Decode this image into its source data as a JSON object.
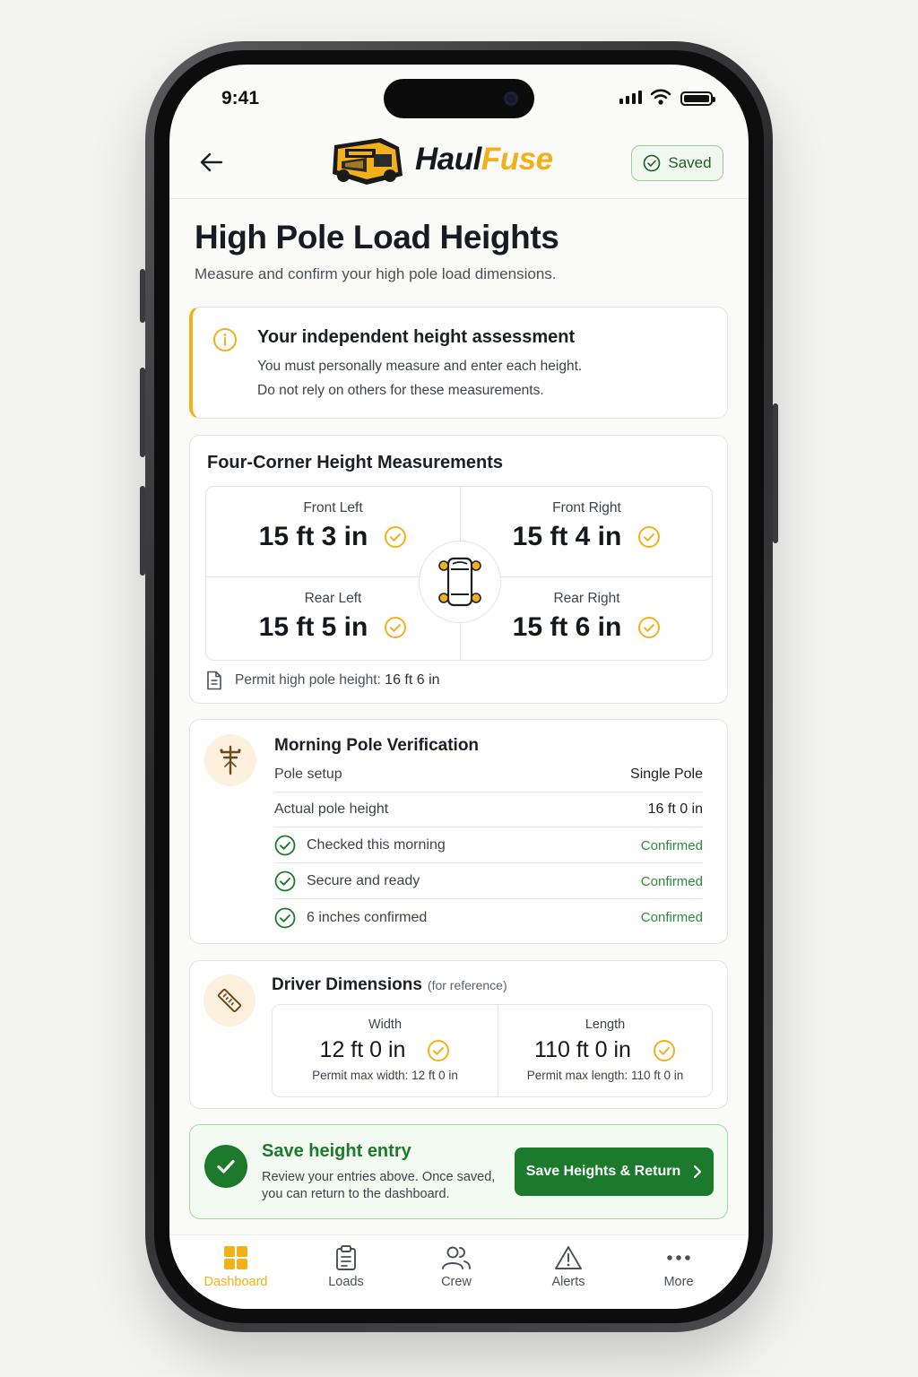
{
  "status": {
    "time": "9:41"
  },
  "header": {
    "brand_haul": "Haul",
    "brand_fuse": "Fuse",
    "saved_label": "Saved"
  },
  "page": {
    "title": "High Pole Load Heights",
    "subtitle": "Measure and confirm your high pole load dimensions."
  },
  "notice": {
    "title": "Your independent height assessment",
    "line1": "You must personally measure and enter each height.",
    "line2": "Do not rely on others for these measurements."
  },
  "corners": {
    "title": "Four-Corner Height Measurements",
    "front_left": {
      "label": "Front Left",
      "value": "15 ft 3 in"
    },
    "front_right": {
      "label": "Front Right",
      "value": "15 ft 4 in"
    },
    "rear_left": {
      "label": "Rear Left",
      "value": "15 ft 5 in"
    },
    "rear_right": {
      "label": "Rear Right",
      "value": "15 ft 6 in"
    },
    "permit_label": "Permit high pole height:",
    "permit_value": "16 ft 6 in"
  },
  "morning": {
    "title": "Morning Pole Verification",
    "pole_setup_label": "Pole setup",
    "pole_setup_value": "Single Pole",
    "actual_height_label": "Actual pole height",
    "actual_height_value": "16 ft 0 in",
    "checks": [
      {
        "label": "Checked this morning",
        "status": "Confirmed"
      },
      {
        "label": "Secure and ready",
        "status": "Confirmed"
      },
      {
        "label": "6 inches confirmed",
        "status": "Confirmed"
      }
    ]
  },
  "driver": {
    "title": "Driver Dimensions",
    "note": "(for reference)",
    "width": {
      "label": "Width",
      "value": "12 ft 0 in",
      "permit": "Permit max width: 12 ft 0 in"
    },
    "length": {
      "label": "Length",
      "value": "110 ft 0 in",
      "permit": "Permit max length: 110 ft 0 in"
    }
  },
  "save": {
    "title": "Save height entry",
    "desc1": "Review your entries above. Once saved,",
    "desc2": "you can return to the dashboard.",
    "button": "Save Heights & Return"
  },
  "tabs": [
    {
      "label": "Dashboard",
      "icon": "grid-icon"
    },
    {
      "label": "Loads",
      "icon": "clipboard-icon"
    },
    {
      "label": "Crew",
      "icon": "users-icon"
    },
    {
      "label": "Alerts",
      "icon": "alert-icon"
    },
    {
      "label": "More",
      "icon": "more-icon"
    }
  ],
  "colors": {
    "accent": "#f2b11a",
    "success": "#1d7a2c",
    "text": "#1c1f24"
  }
}
